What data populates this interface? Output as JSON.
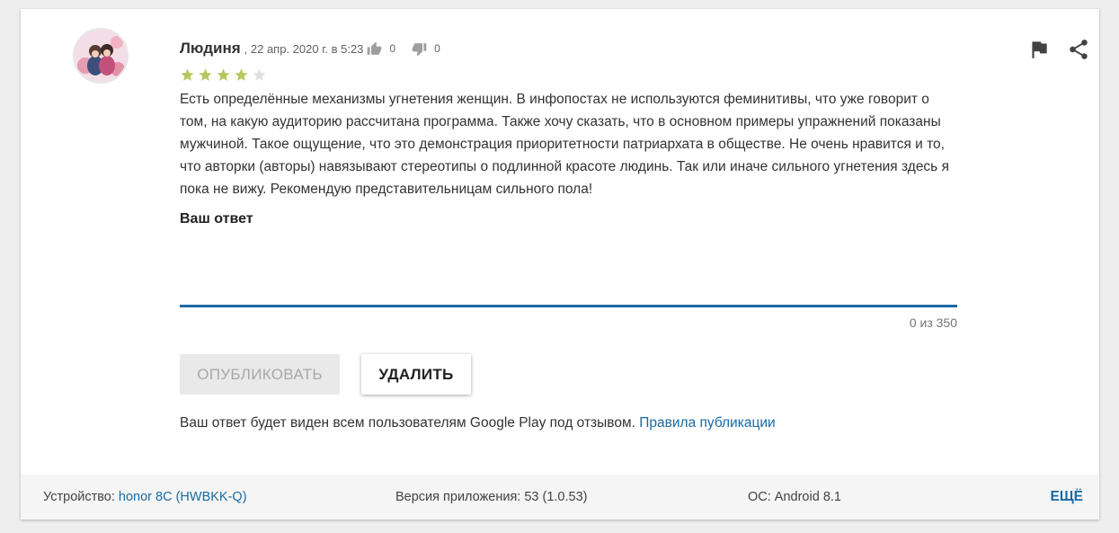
{
  "review": {
    "author": "Людиня",
    "date": ", 22 апр. 2020 г. в 5:23",
    "likes": "0",
    "dislikes": "0",
    "rating": 4,
    "max_rating": 5,
    "text": "Есть определённые механизмы угнетения женщин. В инфопостах не используются феминитивы, что уже говорит о том, на какую аудиторию рассчитана программа. Также хочу сказать, что в основном примеры упражнений показаны мужчиной. Такое ощущение, что это демонстрация приоритетности патриархата в обществе. Не очень нравится и то, что авторки (авторы) навязывают стереотипы о подлинной красоте людинь. Так или иначе сильного угнетения здесь я пока не вижу. Рекомендую представительницам сильного пола!"
  },
  "reply": {
    "label": "Ваш ответ",
    "value": "",
    "counter": "0 из 350",
    "publish_label": "ОПУБЛИКОВАТЬ",
    "delete_label": "УДАЛИТЬ",
    "note": "Ваш ответ будет виден всем пользователям Google Play под отзывом.",
    "rules_link": "Правила публикации"
  },
  "footer": {
    "device_label": "Устройство:",
    "device_value": "honor 8C (HWBKK-Q)",
    "version": "Версия приложения: 53 (1.0.53)",
    "os": "ОС: Android 8.1",
    "more": "ЕЩЁ"
  },
  "icons": {
    "flag": "flag-icon",
    "share": "share-icon",
    "thumb_up": "thumb-up-icon",
    "thumb_down": "thumb-down-icon"
  },
  "colors": {
    "accent": "#1a6aa3",
    "star_filled": "#b5c85f",
    "star_empty": "#e0e0e0"
  }
}
